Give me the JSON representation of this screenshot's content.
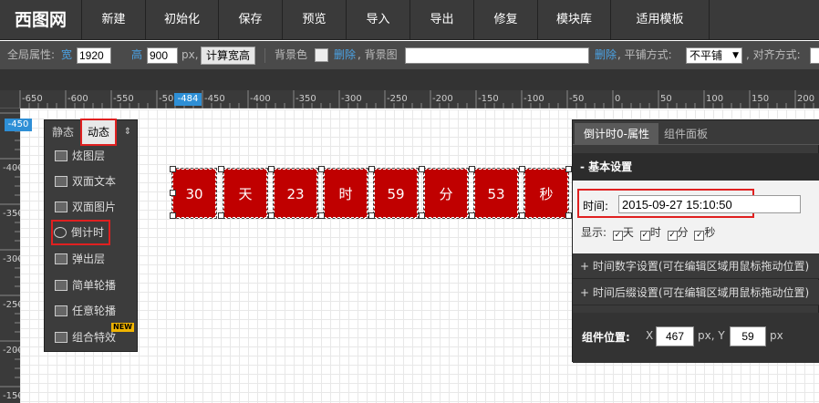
{
  "logo": "西图网",
  "menu": [
    "新建",
    "初始化",
    "保存",
    "预览",
    "导入",
    "导出",
    "修复",
    "模块库",
    "适用模板"
  ],
  "propbar": {
    "global_label": "全局属性:",
    "width_label": "宽",
    "width_value": "1920",
    "height_label": "高",
    "height_value": "900",
    "unit_px": "px,",
    "calc_button": "计算宽高",
    "bg_color_label": "背景色",
    "delete_link": "删除",
    "bg_image_label": ", 背景图",
    "bg_image_value": "",
    "delete_link2": "删除",
    "repeat_label": ", 平铺方式:",
    "repeat_value": "不平铺",
    "align_label": ", 对齐方式:"
  },
  "ruler": {
    "h_labels": [
      "-650",
      "-600",
      "-550",
      "-500",
      "-450",
      "-400",
      "-350",
      "-300",
      "-250",
      "-200",
      "-150",
      "-100",
      "-50",
      "0",
      "50",
      "100",
      "150",
      "200"
    ],
    "h_marker": "-484",
    "v_labels": [
      "-400",
      "-350",
      "-300",
      "-250",
      "-200",
      "-150"
    ],
    "v_marker": "-450"
  },
  "palette": {
    "tab_static": "静态",
    "tab_dynamic": "动态",
    "collapse_glyph": "⇕",
    "items": [
      "炫图层",
      "双面文本",
      "双面图片",
      "倒计时",
      "弹出层",
      "简单轮播",
      "任意轮播",
      "组合特效"
    ],
    "new_badge": "NEW"
  },
  "countdown": [
    "30",
    "天",
    "23",
    "时",
    "59",
    "分",
    "53",
    "秒"
  ],
  "props": {
    "tab_props": "倒计时0-属性",
    "tab_panel": "组件面板",
    "basic_header": "- 基本设置",
    "time_label": "时间:",
    "time_value": "2015-09-27 15:10:50",
    "display_label": "显示:",
    "display_opts": [
      "天",
      "时",
      "分",
      "秒"
    ],
    "section_number": "+ 时间数字设置(可在编辑区域用鼠标拖动位置)",
    "section_suffix": "+ 时间后缀设置(可在编辑区域用鼠标拖动位置)",
    "pos_label": "组件位置:",
    "x_label": "X",
    "x_value": "467",
    "y_label": "px, Y",
    "y_value": "59",
    "y_unit": "px"
  },
  "colors": {
    "accent_blue": "#2e8fd6",
    "highlight_red": "#e02020",
    "countdown_red": "#c00000"
  }
}
